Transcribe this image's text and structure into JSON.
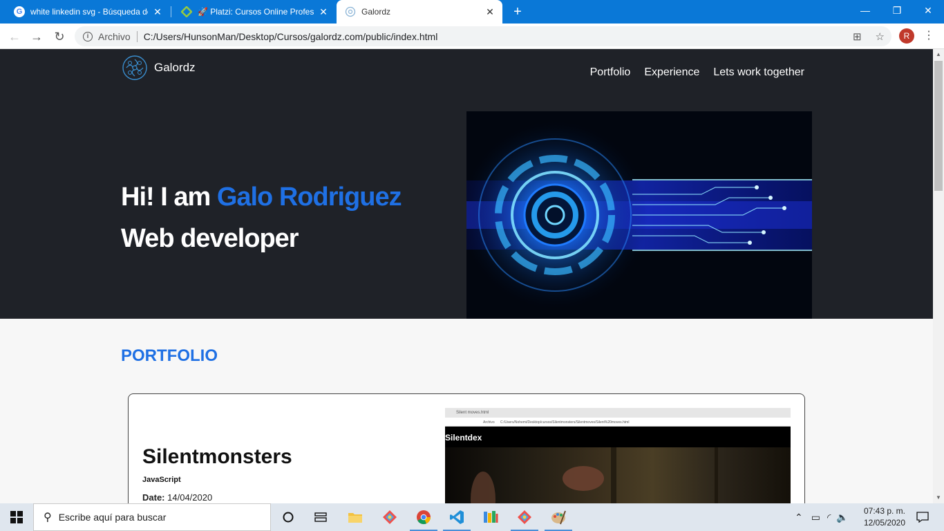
{
  "browser": {
    "tabs": [
      {
        "title": "white linkedin svg - Búsqueda de",
        "icon": "google-icon"
      },
      {
        "title": "🚀 Platzi: Cursos Online Profesion",
        "icon": "platzi-icon"
      },
      {
        "title": "Galordz",
        "icon": "galordz-icon",
        "active": true
      }
    ],
    "close_glyph": "✕",
    "new_tab_glyph": "+",
    "window_controls": [
      "—",
      "❐",
      "✕"
    ],
    "address": {
      "label": "Archivo",
      "url": "C:/Users/HunsonMan/Desktop/Cursos/galordz.com/public/index.html"
    },
    "profile_initial": "R"
  },
  "site": {
    "logo_text": "Galordz",
    "nav": [
      "Portfolio",
      "Experience",
      "Lets work together"
    ],
    "hero": {
      "line1_prefix": "Hi! I am ",
      "line1_name": "Galo Rodriguez",
      "line2": "Web developer"
    },
    "portfolio_heading": "PORTFOLIO",
    "project": {
      "title": "Silentmonsters",
      "tag": "JavaScript",
      "date_label": "Date:",
      "date_value": "14/04/2020",
      "screenshot": {
        "tab_title": "Silent moves.html",
        "address_label": "Archivo",
        "url": "C:/Users/Nohemi/Desktop/cursos/Silentmonsters/Silentmoves/Silent%20moves.html",
        "heading": "Silentdex"
      }
    },
    "accent_color": "#1f70e4"
  },
  "taskbar": {
    "search_placeholder": "Escribe aquí para buscar",
    "time": "07:43 p. m.",
    "date": "12/05/2020"
  }
}
